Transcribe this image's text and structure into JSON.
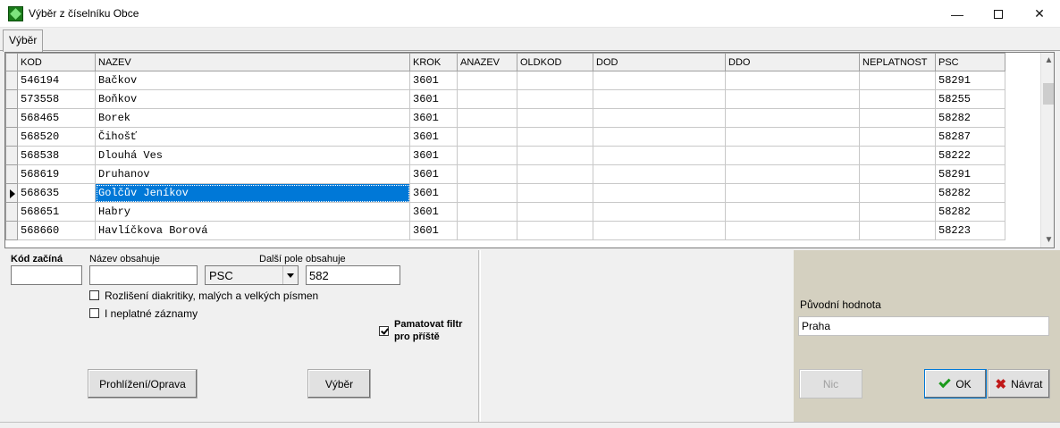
{
  "window": {
    "title": "Výběr z číselníku Obce",
    "min_glyph": "—",
    "close_glyph": "✕"
  },
  "tabs": [
    {
      "label": "Výběr"
    }
  ],
  "grid": {
    "columns": [
      "KOD",
      "NAZEV",
      "KROK",
      "ANAZEV",
      "OLDKOD",
      "DOD",
      "DDO",
      "NEPLATNOST",
      "PSC"
    ],
    "rows": [
      {
        "kod": "546194",
        "nazev": "Bačkov",
        "krok": "3601",
        "psc": "58291"
      },
      {
        "kod": "573558",
        "nazev": "Boňkov",
        "krok": "3601",
        "psc": "58255"
      },
      {
        "kod": "568465",
        "nazev": "Borek",
        "krok": "3601",
        "psc": "58282"
      },
      {
        "kod": "568520",
        "nazev": "Čihošť",
        "krok": "3601",
        "psc": "58287"
      },
      {
        "kod": "568538",
        "nazev": "Dlouhá Ves",
        "krok": "3601",
        "psc": "58222"
      },
      {
        "kod": "568619",
        "nazev": "Druhanov",
        "krok": "3601",
        "psc": "58291"
      },
      {
        "kod": "568635",
        "nazev": "Golčův Jeníkov",
        "krok": "3601",
        "psc": "58282"
      },
      {
        "kod": "568651",
        "nazev": "Habry",
        "krok": "3601",
        "psc": "58282"
      },
      {
        "kod": "568660",
        "nazev": "Havlíčkova Borová",
        "krok": "3601",
        "psc": "58223"
      }
    ],
    "selected_row": 6,
    "scroll_up": "▲",
    "scroll_down": "▼"
  },
  "filter": {
    "kod_label": "Kód začíná",
    "kod_value": "",
    "nazev_label": "Název obsahuje",
    "nazev_value": "",
    "combo_value": "PSC",
    "dalsi_label": "Další pole",
    "obsahuje_label": "obsahuje",
    "obsahuje_value": "582",
    "chk_diakritika": "Rozlišení diakritiky, malých a velkých písmen",
    "chk_neplatne": "I neplatné záznamy",
    "chk_pamatovat_1": "Pamatovat filtr",
    "chk_pamatovat_2": "pro příště",
    "btn_prohlizeni": "Prohlížení/Oprava",
    "btn_vyber": "Výběr"
  },
  "right": {
    "puvodni_label": "Původní hodnota",
    "puvodni_value": "Praha",
    "btn_nic": "Nic",
    "btn_ok": "OK",
    "btn_navrat": "Návrat"
  }
}
